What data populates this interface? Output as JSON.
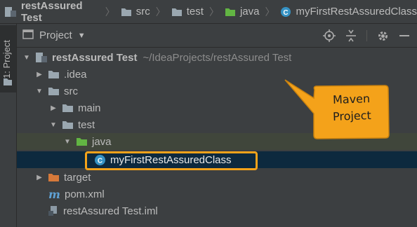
{
  "breadcrumb": {
    "items": [
      {
        "label": "restAssured Test",
        "icon": "project-module-icon",
        "bold": true
      },
      {
        "label": "src",
        "icon": "folder-icon"
      },
      {
        "label": "test",
        "icon": "folder-icon"
      },
      {
        "label": "java",
        "icon": "green-folder-icon"
      },
      {
        "label": "myFirstRestAssuredClass",
        "icon": "java-class-icon"
      }
    ]
  },
  "toolwindow": {
    "label": "1: Project"
  },
  "panel": {
    "title": "Project",
    "header_icons": [
      "locate-icon",
      "collapse-all-icon",
      "gear-icon",
      "minimize-icon"
    ]
  },
  "tree": [
    {
      "label": "restAssured Test",
      "path": "~/IdeaProjects/restAssured Test",
      "expanded": true,
      "icon": "project-module-icon",
      "bold": true
    },
    {
      "label": ".idea",
      "expanded": false,
      "icon": "folder-icon"
    },
    {
      "label": "src",
      "expanded": true,
      "icon": "folder-icon"
    },
    {
      "label": "main",
      "expanded": false,
      "icon": "folder-icon"
    },
    {
      "label": "test",
      "expanded": true,
      "icon": "folder-icon"
    },
    {
      "label": "java",
      "expanded": true,
      "icon": "green-folder-icon"
    },
    {
      "label": "myFirstRestAssuredClass",
      "icon": "java-class-icon",
      "selected": true
    },
    {
      "label": "target",
      "expanded": false,
      "icon": "orange-folder-icon"
    },
    {
      "label": "pom.xml",
      "icon": "maven-icon"
    },
    {
      "label": "restAssured Test.iml",
      "icon": "iml-file-icon"
    }
  ],
  "callout": {
    "line1": "Maven",
    "line2": "Project"
  },
  "colors": {
    "accent": "#f4a21a",
    "selection": "#0d293e",
    "green_folder": "#62b543",
    "blue_class": "#3592c4"
  }
}
